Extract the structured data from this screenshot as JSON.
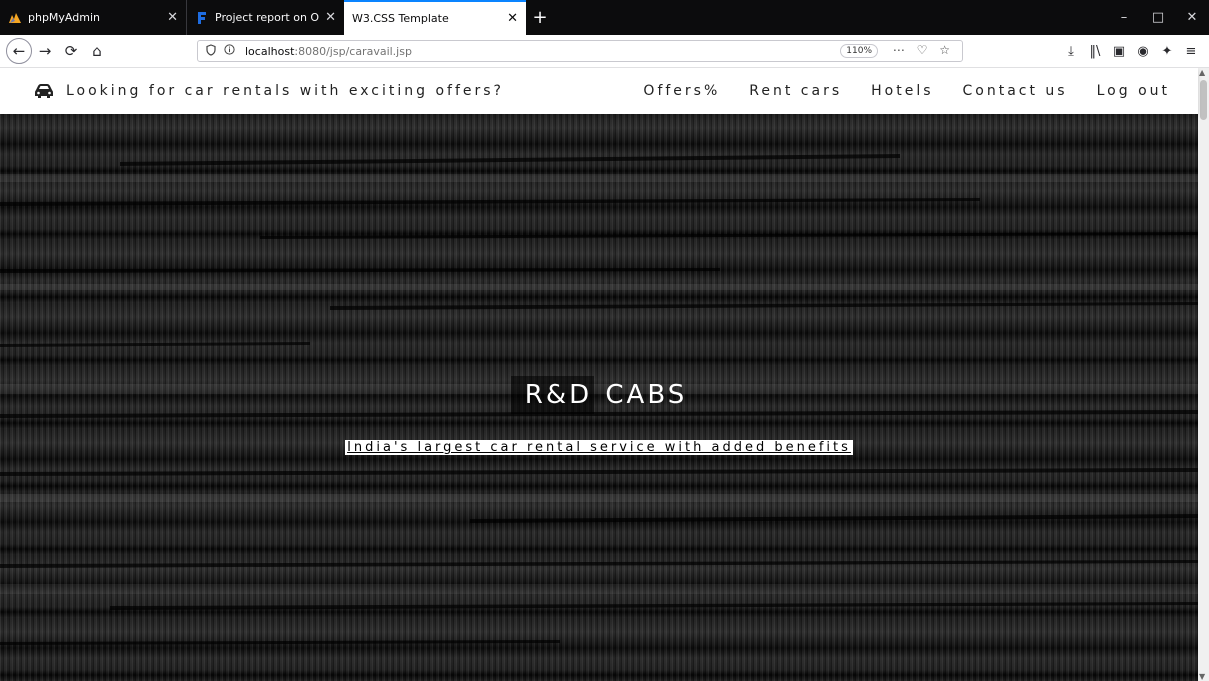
{
  "browser": {
    "tabs": [
      {
        "title": "phpMyAdmin",
        "icon": "phpmyadmin-icon"
      },
      {
        "title": "Project report on Online Car Re",
        "icon": "document-icon"
      },
      {
        "title": "W3.CSS Template",
        "icon": "none",
        "active": true
      }
    ],
    "new_tab_label": "+",
    "window_controls": {
      "minimize": "–",
      "restore": "□",
      "close": "✕"
    },
    "nav": {
      "back": "←",
      "forward": "→",
      "reload": "⟳",
      "home": "⌂"
    },
    "url_host": "localhost",
    "url_rest": ":8080/jsp/caravail.jsp",
    "zoom": "110%",
    "url_actions": "⋯ ♡ ☆",
    "tools": {
      "download": "⤓",
      "library": "‖\\",
      "sidebar": "▣",
      "account": "◉",
      "extension": "✦",
      "menu": "≡"
    }
  },
  "site": {
    "brand": "Looking for car rentals with exciting offers?",
    "menu": [
      "Offers%",
      "Rent cars",
      "Hotels",
      "Contact us",
      "Log out"
    ],
    "hero": {
      "title_highlight": "R&D",
      "title_rest": " CABS",
      "subtitle": "India's largest car rental service with added benefits"
    }
  },
  "colors": {
    "accent": "#0a84ff",
    "tabbar": "#0c0c0d",
    "hero": "#1a1a1a"
  }
}
